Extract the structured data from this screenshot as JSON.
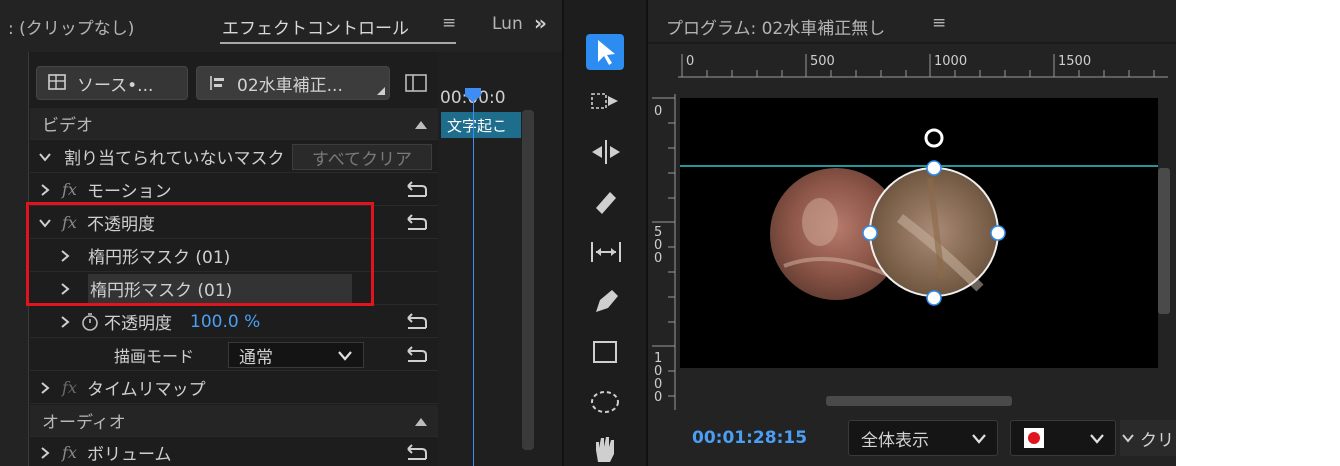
{
  "left_panel": {
    "tab_clip": ": (クリップなし)",
    "tab_effect_controls": "エフェクトコントロール",
    "tab_menu_glyph": "≡",
    "tab_lumetri": "Lun",
    "overflow_glyph": "»",
    "source_chip": "ソース•...",
    "sequence_chip": "02水車補正...",
    "timecode_partial": "00:00:0",
    "clip_label": "文字起こ",
    "video_section": "ビデオ",
    "unassigned_mask": "割り当てられていないマスク",
    "clear_all_button": "すべてクリア",
    "motion": "モーション",
    "opacity": "不透明度",
    "mask1": "楕円形マスク (01)",
    "mask2": "楕円形マスク (01)",
    "opacity_param": "不透明度",
    "opacity_value": "100.0 %",
    "blend_mode_label": "描画モード",
    "blend_mode_value": "通常",
    "time_remap": "タイムリマップ",
    "audio_section": "オーディオ",
    "volume": "ボリューム",
    "fx_label": "fx"
  },
  "monitor": {
    "title": "プログラム: 02水車補正無し",
    "menu_glyph": "≡",
    "ruler_top_labels": [
      "0",
      "500",
      "1000",
      "1500"
    ],
    "ruler_left_labels": [
      "0",
      "5\n0\n0",
      "1\n0\n0\n0"
    ],
    "timecode": "00:01:28:15",
    "zoom_value": "全体表示",
    "clip_button_partial": "クリ"
  },
  "colors": {
    "accent_blue": "#3d8df5",
    "timecode_blue": "#4a9ff5",
    "highlight_red": "#e0141e",
    "guide_cyan": "#31c7cf",
    "panel_bg": "#232323"
  }
}
